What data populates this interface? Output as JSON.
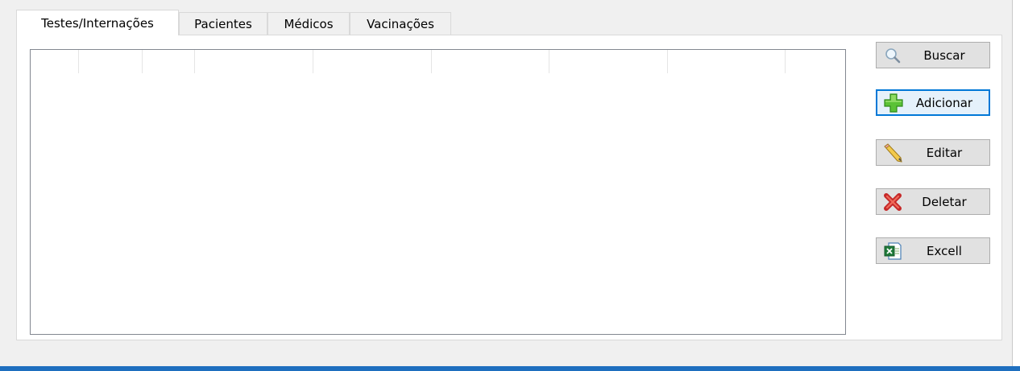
{
  "tabs": [
    {
      "label": "Testes/Internações",
      "active": true
    },
    {
      "label": "Pacientes",
      "active": false
    },
    {
      "label": "Médicos",
      "active": false
    },
    {
      "label": "Vacinações",
      "active": false
    }
  ],
  "buttons": {
    "buscar": {
      "label": "Buscar",
      "icon": "magnifier-icon"
    },
    "adicionar": {
      "label": "Adicionar",
      "icon": "green-plus-icon"
    },
    "editar": {
      "label": "Editar",
      "icon": "pencil-icon"
    },
    "deletar": {
      "label": "Deletar",
      "icon": "red-x-icon"
    },
    "excel": {
      "label": "Excell",
      "icon": "excel-file-icon"
    }
  },
  "colors": {
    "accent": "#0078d7",
    "taskbar": "#1e6fbf"
  }
}
